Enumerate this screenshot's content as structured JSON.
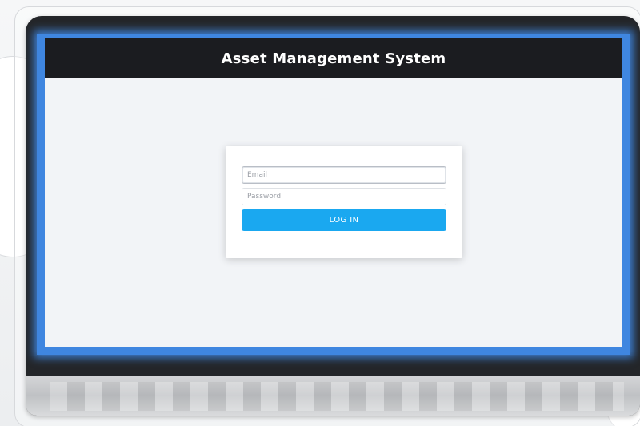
{
  "app": {
    "title": "Asset Management System"
  },
  "login_form": {
    "email_placeholder": "Email",
    "email_value": "",
    "password_placeholder": "Password",
    "password_value": "",
    "submit_label": "LOG IN"
  },
  "colors": {
    "header_background": "#1b1c20",
    "screen_background": "#f2f4f7",
    "screen_glow": "#3f86e0",
    "button_primary": "#1aa8f0",
    "button_text": "#ffffff"
  }
}
